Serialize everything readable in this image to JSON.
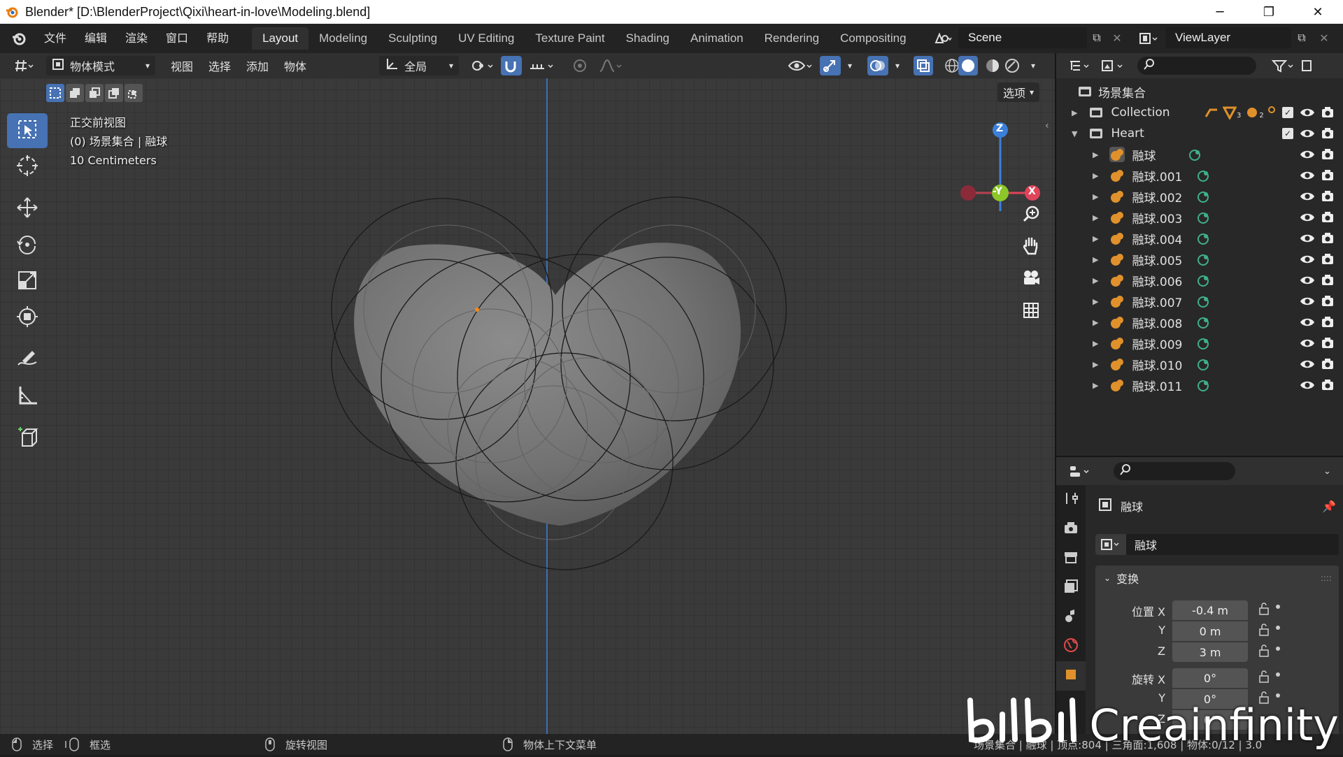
{
  "window": {
    "title": "Blender* [D:\\BlenderProject\\Qixi\\heart-in-love\\Modeling.blend]",
    "minimize_icon": "minimize-icon",
    "restore_icon": "restore-icon",
    "close_icon": "close-icon"
  },
  "menubar": {
    "items": [
      "文件",
      "编辑",
      "渲染",
      "窗口",
      "帮助"
    ],
    "workspaces": [
      "Layout",
      "Modeling",
      "Sculpting",
      "UV Editing",
      "Texture Paint",
      "Shading",
      "Animation",
      "Rendering",
      "Compositing"
    ],
    "active_workspace": "Layout",
    "scene": "Scene",
    "view_layer": "ViewLayer"
  },
  "viewport_header": {
    "mode": "物体模式",
    "menus": [
      "视图",
      "选择",
      "添加",
      "物体"
    ],
    "transform_orientation": "全局",
    "options_label": "选项"
  },
  "viewport": {
    "view_name": "正交前视图",
    "collection_info": "(0) 场景集合 | 融球",
    "grid_scale": "10 Centimeters",
    "gizmo": {
      "z": "Z",
      "neg_y": "-Y",
      "x": "X"
    },
    "colors": {
      "x_axis": "#e0445a",
      "y_axis": "#8bc728",
      "z_axis": "#3b7fd8",
      "origin": "#f08a18"
    }
  },
  "outliner": {
    "root": "场景集合",
    "collections": [
      {
        "name": "Collection",
        "badge_mesh": "3",
        "badge_obj": "2"
      },
      {
        "name": "Heart"
      }
    ],
    "objects": [
      "融球",
      "融球.001",
      "融球.002",
      "融球.003",
      "融球.004",
      "融球.005",
      "融球.006",
      "融球.007",
      "融球.008",
      "融球.009",
      "融球.010",
      "融球.011"
    ]
  },
  "properties": {
    "object_name": "融球",
    "data_name": "融球",
    "panel_transform": "变换",
    "location_label": "位置 X",
    "rotation_label": "旋转 X",
    "y_label": "Y",
    "z_label": "Z",
    "location": {
      "x": "-0.4 m",
      "y": "0 m",
      "z": "3 m"
    },
    "rotation": {
      "x": "0°",
      "y": "0°",
      "z": "0°"
    }
  },
  "statusbar": {
    "select": "选择",
    "box_select": "框选",
    "rotate_view": "旋转视图",
    "context_menu": "物体上下文菜单",
    "stats": "场景集合 | 融球 | 顶点:804 | 三角面:1,608 | 物体:0/12 | 3.0"
  },
  "watermark": {
    "text": "Creainfinity"
  }
}
